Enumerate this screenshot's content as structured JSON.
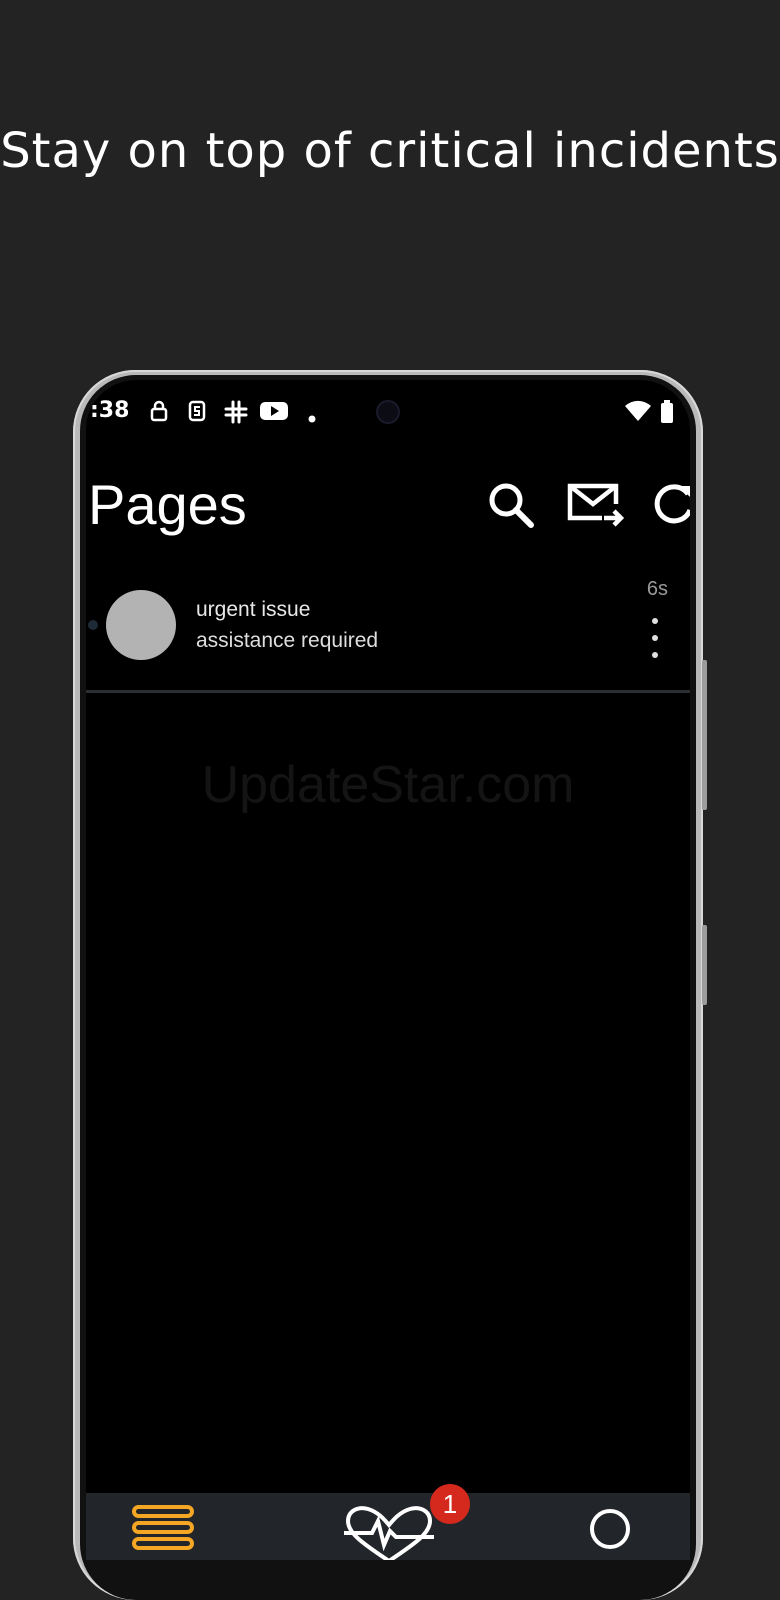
{
  "headline": "Stay on top of critical incidents",
  "status_bar": {
    "time": ":38",
    "icons": [
      "lock-icon",
      "s-app-icon",
      "slack-icon",
      "youtube-icon",
      "dot-icon",
      "wifi-icon",
      "battery-icon"
    ]
  },
  "app_bar": {
    "title": "Pages",
    "actions": [
      "search-icon",
      "mail-forward-icon",
      "refresh-icon"
    ]
  },
  "pages": [
    {
      "title": "urgent issue",
      "subtitle": "assistance required",
      "time": "6s",
      "unread": true
    }
  ],
  "watermark": "UpdateStar.com",
  "bottom_nav": {
    "items": [
      "list-icon",
      "heart-pulse-icon",
      "search-icon"
    ],
    "badge_count": "1"
  },
  "colors": {
    "background": "#232323",
    "screen": "#000000",
    "accent": "#f5a623",
    "badge": "#d6291d",
    "avatar": "#b3b3b3",
    "nav_bg": "#22262b"
  }
}
